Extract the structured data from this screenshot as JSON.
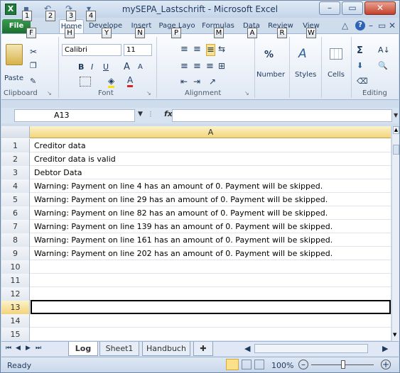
{
  "window": {
    "title": "mySEPA_Lastschrift - Microsoft Excel",
    "minimize_icon": "minimize-icon",
    "maximize_icon": "maximize-icon",
    "close_icon": "close-icon"
  },
  "keytips": {
    "qat1": "1",
    "qat2": "2",
    "qat3": "3",
    "qat4": "4",
    "file": "F",
    "home": "H",
    "developer": "Y",
    "insert": "N",
    "page_layout": "P",
    "formulas": "M",
    "data": "A",
    "review": "R",
    "view": "W"
  },
  "tabs": {
    "file": "File",
    "home": "Home",
    "developer": "Develope",
    "insert": "Insert",
    "page_layout": "Page Layo",
    "formulas": "Formulas",
    "data": "Data",
    "review": "Review",
    "view": "View"
  },
  "ribbon": {
    "clipboard": {
      "label": "Clipboard",
      "paste": "Paste"
    },
    "font": {
      "label": "Font",
      "name": "Calibri",
      "size": "11",
      "bold": "B",
      "italic": "I",
      "underline": "U",
      "grow": "A",
      "shrink": "A"
    },
    "alignment": {
      "label": "Alignment"
    },
    "number": {
      "label": "Number",
      "percent": "%"
    },
    "styles": {
      "label": "Styles"
    },
    "cells": {
      "label": "Cells"
    },
    "editing": {
      "label": "Editing",
      "sum": "Σ"
    }
  },
  "formula_bar": {
    "name_box": "A13",
    "fx": "fx",
    "formula": ""
  },
  "grid": {
    "column_a": "A",
    "rows": [
      {
        "num": "1",
        "text": "Creditor data"
      },
      {
        "num": "2",
        "text": "Creditor data is valid"
      },
      {
        "num": "3",
        "text": "Debtor Data"
      },
      {
        "num": "4",
        "text": "Warning: Payment on line 4 has an amount of 0. Payment will be skipped."
      },
      {
        "num": "5",
        "text": "Warning: Payment on line 29 has an amount of 0. Payment will be skipped."
      },
      {
        "num": "6",
        "text": "Warning: Payment on line 82 has an amount of 0. Payment will be skipped."
      },
      {
        "num": "7",
        "text": "Warning: Payment on line 139 has an amount of 0. Payment will be skipped."
      },
      {
        "num": "8",
        "text": "Warning: Payment on line 161 has an amount of 0. Payment will be skipped."
      },
      {
        "num": "9",
        "text": "Warning: Payment on line 202 has an amount of 0. Payment will be skipped."
      },
      {
        "num": "10",
        "text": ""
      },
      {
        "num": "11",
        "text": ""
      },
      {
        "num": "12",
        "text": ""
      },
      {
        "num": "13",
        "text": ""
      },
      {
        "num": "14",
        "text": ""
      },
      {
        "num": "15",
        "text": ""
      }
    ],
    "selected_row": "13"
  },
  "sheets": {
    "log": "Log",
    "sheet1": "Sheet1",
    "handbuch": "Handbuch"
  },
  "status": {
    "ready": "Ready",
    "zoom": "100%"
  }
}
